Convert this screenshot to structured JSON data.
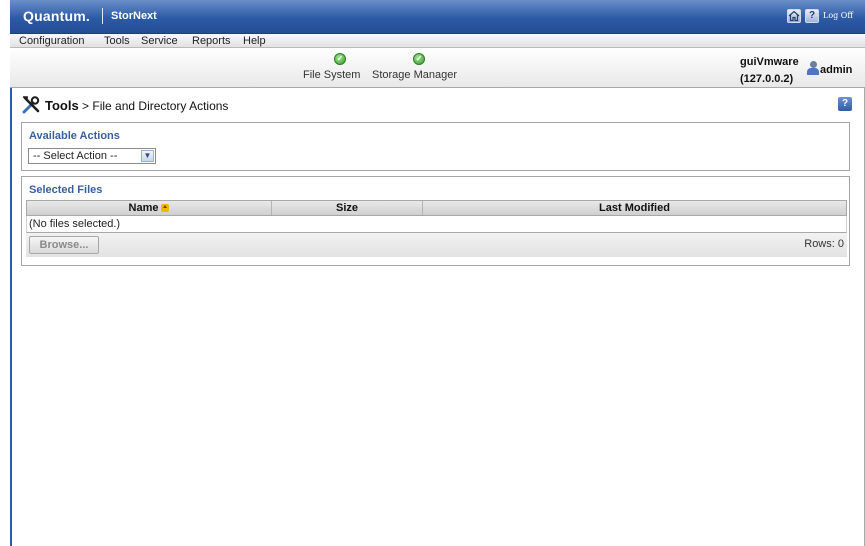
{
  "header": {
    "brand": "Quantum.",
    "product": "StorNext",
    "help_glyph": "?",
    "logoff_label": "Log Off"
  },
  "menu": {
    "items": [
      "Configuration",
      "Tools",
      "Service",
      "Reports",
      "Help"
    ]
  },
  "status": {
    "items": [
      {
        "label": "File System",
        "state": "ok"
      },
      {
        "label": "Storage Manager",
        "state": "ok"
      }
    ],
    "host_name": "guiVmware",
    "host_ip": "(127.0.0.2)",
    "username": "admin"
  },
  "page": {
    "title_bold": "Tools",
    "title_rest": " > File and Directory Actions",
    "help_glyph": "?"
  },
  "actions": {
    "heading": "Available Actions",
    "select_value": "-- Select Action --"
  },
  "files": {
    "heading": "Selected Files",
    "columns": [
      "Name",
      "Size",
      "Last Modified"
    ],
    "sort_column": "Name",
    "sort_direction": "ascending",
    "empty_text": "(No files selected.)",
    "browse_label": "Browse...",
    "rows_label": "Rows: 0"
  },
  "colors": {
    "title_bar": "#2c5aa6",
    "section_heading": "#3a5f9e",
    "status_ok": "#3b9e2f",
    "sort_icon": "#f2b705"
  },
  "icons": [
    "home-icon",
    "help-icon",
    "check-circle-icon",
    "user-icon",
    "tools-icon",
    "chevron-down-icon",
    "sort-ascending-icon"
  ]
}
